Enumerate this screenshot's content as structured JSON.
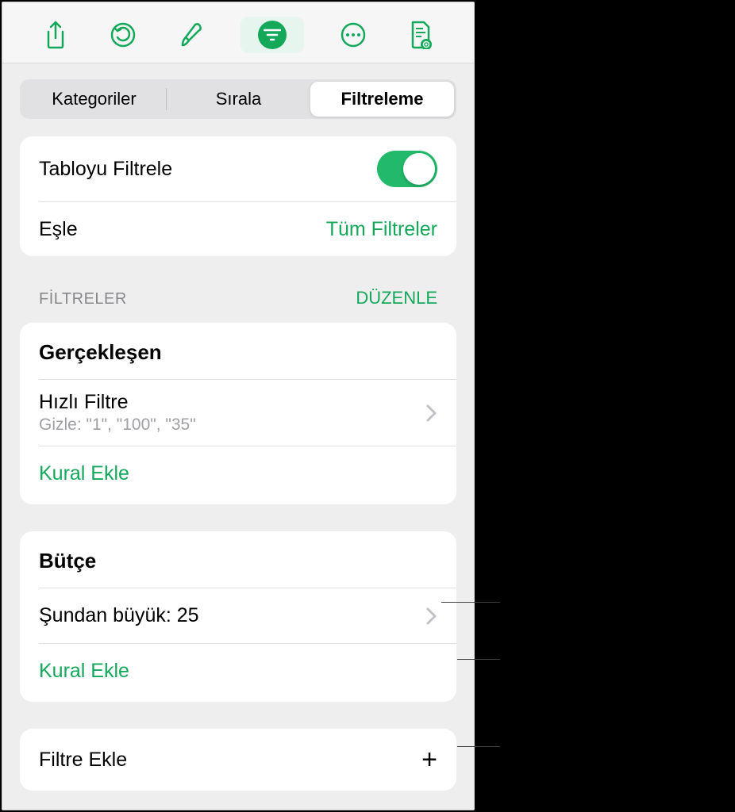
{
  "toolbar": {
    "icons": [
      "share-icon",
      "undo-icon",
      "brush-icon",
      "filter-icon",
      "more-icon",
      "document-preview-icon"
    ]
  },
  "segmented": {
    "items": [
      "Kategoriler",
      "Sırala",
      "Filtreleme"
    ],
    "active": 2
  },
  "filterTable": {
    "label": "Tabloyu Filtrele",
    "on": true
  },
  "match": {
    "label": "Eşle",
    "value": "Tüm Filtreler"
  },
  "section": {
    "title": "FİLTRELER",
    "edit": "DÜZENLE"
  },
  "groups": [
    {
      "title": "Gerçekleşen",
      "rules": [
        {
          "label": "Hızlı Filtre",
          "sub": "Gizle: \"1\", \"100\", \"35\""
        }
      ],
      "addRule": "Kural Ekle"
    },
    {
      "title": "Bütçe",
      "rules": [
        {
          "label": "Şundan büyük: 25",
          "sub": ""
        }
      ],
      "addRule": "Kural Ekle"
    }
  ],
  "addFilter": {
    "label": "Filtre Ekle"
  },
  "colors": {
    "accent": "#14a85a"
  }
}
